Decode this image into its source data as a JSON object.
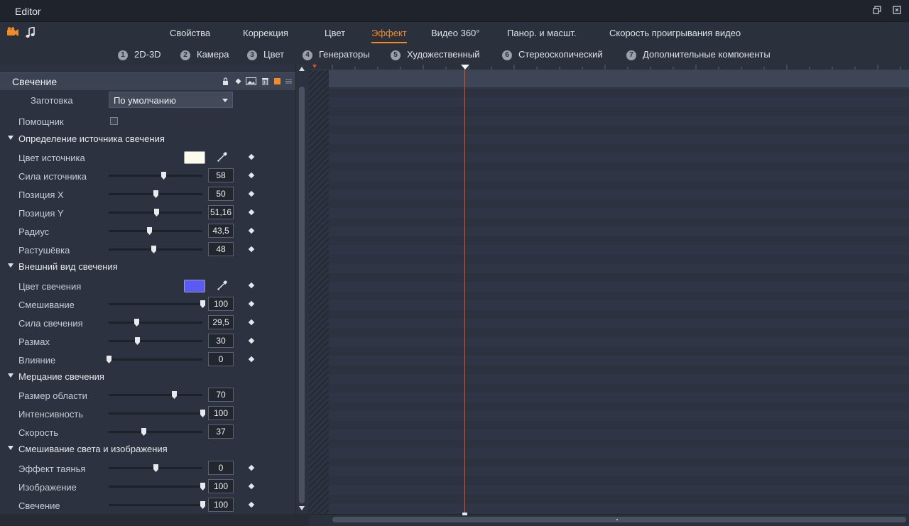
{
  "window": {
    "title": "Editor"
  },
  "top_tabs": [
    {
      "label": "Свойства",
      "active": false
    },
    {
      "label": "Коррекция",
      "active": false
    },
    {
      "label": "Цвет",
      "active": false
    },
    {
      "label": "Эффект",
      "active": true
    },
    {
      "label": "Видео 360°",
      "active": false
    },
    {
      "label": "Панор. и масшт.",
      "active": false
    },
    {
      "label": "Скорость проигрывания видео",
      "active": false
    }
  ],
  "sub_tabs": [
    {
      "num": "1",
      "label": "2D-3D"
    },
    {
      "num": "2",
      "label": "Камера"
    },
    {
      "num": "3",
      "label": "Цвет"
    },
    {
      "num": "4",
      "label": "Генераторы"
    },
    {
      "num": "5",
      "label": "Художественный"
    },
    {
      "num": "6",
      "label": "Стереоскопический"
    },
    {
      "num": "7",
      "label": "Дополнительные компоненты"
    }
  ],
  "effect": {
    "title": "Свечение",
    "preset_label": "Заготовка",
    "preset_value": "По умолчанию",
    "helper_label": "Помощник",
    "helper_checked": false
  },
  "sections": [
    {
      "title": "Определение источника свечения"
    },
    {
      "title": "Внешний вид свечения"
    },
    {
      "title": "Мерцание свечения"
    },
    {
      "title": "Смешивание света и изображения"
    }
  ],
  "params": {
    "source_color": {
      "label": "Цвет источника",
      "color": "#fdfbe9"
    },
    "source_strength": {
      "label": "Сила источника",
      "value": "58",
      "fraction": 0.58
    },
    "pos_x": {
      "label": "Позиция X",
      "value": "50",
      "fraction": 0.5
    },
    "pos_y": {
      "label": "Позиция Y",
      "value": "51,16",
      "fraction": 0.51
    },
    "radius": {
      "label": "Радиус",
      "value": "43,5",
      "fraction": 0.435
    },
    "feather": {
      "label": "Растушёвка",
      "value": "48",
      "fraction": 0.48
    },
    "glow_color": {
      "label": "Цвет свечения",
      "color": "#5a5af5"
    },
    "blending": {
      "label": "Смешивание",
      "value": "100",
      "fraction": 1.0
    },
    "glow_strength": {
      "label": "Сила свечения",
      "value": "29,5",
      "fraction": 0.295
    },
    "spread": {
      "label": "Размах",
      "value": "30",
      "fraction": 0.3
    },
    "influence": {
      "label": "Влияние",
      "value": "0",
      "fraction": 0.0
    },
    "area_size": {
      "label": "Размер области",
      "value": "70",
      "fraction": 0.7
    },
    "intensity": {
      "label": "Интенсивность",
      "value": "100",
      "fraction": 1.0
    },
    "speed": {
      "label": "Скорость",
      "value": "37",
      "fraction": 0.37
    },
    "melt": {
      "label": "Эффект таянья",
      "value": "0",
      "fraction": 0.5
    },
    "image": {
      "label": "Изображение",
      "value": "100",
      "fraction": 1.0
    },
    "glow": {
      "label": "Свечение",
      "value": "100",
      "fraction": 1.0
    }
  },
  "colors": {
    "accent": "#f08b2a",
    "playhead": "#e0502f"
  }
}
